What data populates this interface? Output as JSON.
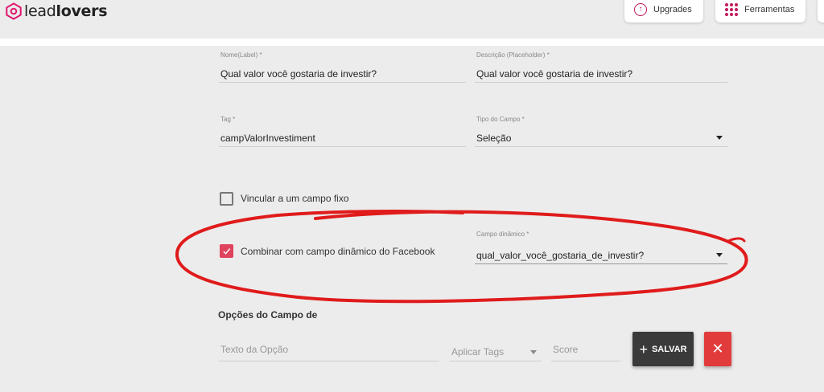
{
  "header": {
    "logo_text_light": "lead",
    "logo_text_bold": "lovers",
    "upgrades_label": "Upgrades",
    "ferramentas_label": "Ferramentas"
  },
  "form": {
    "nome": {
      "label": "Nome(Label) *",
      "value": "Qual valor você gostaria de investir?"
    },
    "descricao": {
      "label": "Descrição (Placeholder) *",
      "value": "Qual valor você gostaria de investir?"
    },
    "tag": {
      "label": "Tag *",
      "value": "campValorInvestiment"
    },
    "tipo": {
      "label": "Tipo do Campo *",
      "value": "Seleção"
    },
    "vincular": {
      "label": "Vincular a um campo fixo",
      "checked": false
    },
    "combinar": {
      "label": "Combinar com campo dinâmico do Facebook",
      "checked": true
    },
    "campo_dinamico": {
      "label": "Campo dinâmico *",
      "value": "qual_valor_você_gostaria_de_investir?"
    }
  },
  "options": {
    "title": "Opções do Campo de",
    "texto_placeholder": "Texto da Opção",
    "tags_placeholder": "Aplicar Tags",
    "score_placeholder": "Score",
    "save_label": "SALVAR"
  },
  "colors": {
    "accent": "#e0435d",
    "brand": "#c2185b",
    "annotation": "#e01b1b",
    "delete": "#e23b3b"
  }
}
